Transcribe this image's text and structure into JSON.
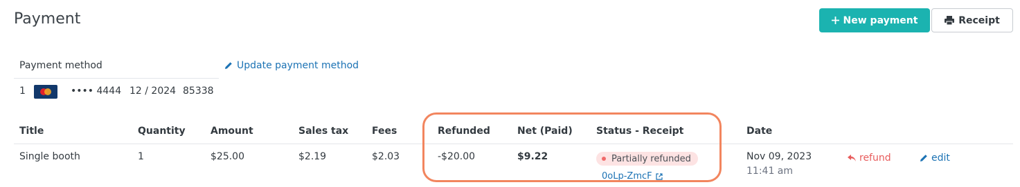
{
  "header": {
    "title": "Payment",
    "new_payment_label": "New payment",
    "receipt_label": "Receipt",
    "new_payment_icon": "plus-icon",
    "receipt_icon": "printer-icon"
  },
  "payment_method": {
    "label": "Payment method",
    "update_label": "Update payment method",
    "update_icon": "pencil-icon",
    "row": {
      "index": "1",
      "card_brand": "MasterCard",
      "card_number": "•••• 4444",
      "expiry": "12 / 2024",
      "postal": "85338"
    }
  },
  "table": {
    "headers": {
      "title": "Title",
      "quantity": "Quantity",
      "amount": "Amount",
      "sales_tax": "Sales tax",
      "fees": "Fees",
      "refunded": "Refunded",
      "net": "Net (Paid)",
      "status": "Status - Receipt",
      "date": "Date"
    },
    "row": {
      "title": "Single booth",
      "quantity": "1",
      "amount": "$25.00",
      "sales_tax": "$2.19",
      "fees": "$2.03",
      "refunded": "-$20.00",
      "net": "$9.22",
      "status": "Partially refunded",
      "receipt_id": "0oLp-ZmcF",
      "date": "Nov 09, 2023",
      "time": "11:41 am",
      "refund_label": "refund",
      "edit_label": "edit"
    }
  },
  "colors": {
    "accent": "#1bb3b0",
    "link": "#1b72b4",
    "refund": "#e85c5c",
    "badge_bg": "#fde3e3",
    "highlight": "#f2855e"
  }
}
